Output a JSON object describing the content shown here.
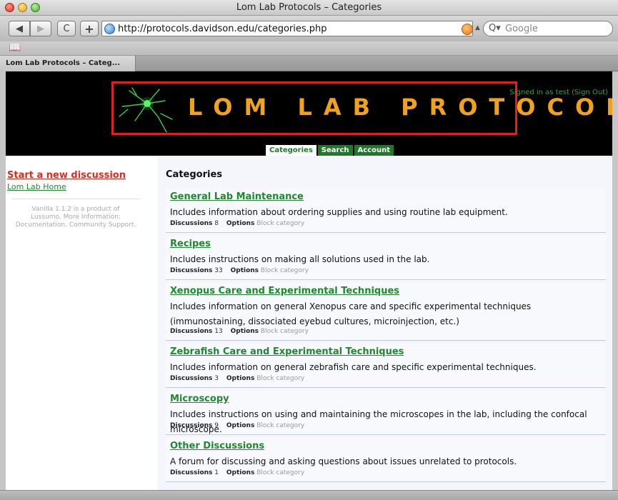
{
  "window": {
    "title": "Lom Lab Protocols – Categories"
  },
  "toolbar": {
    "back": "◀",
    "forward": "▶",
    "reload": "C",
    "add": "+",
    "url": "http://protocols.davidson.edu/categories.php",
    "search_placeholder": "Google",
    "search_icon": "Q▾"
  },
  "bookmarks": {
    "icon": "book-icon"
  },
  "tab": {
    "label": "Lom Lab Protocols – Categ..."
  },
  "header": {
    "logo_text": "LOM LAB PROTOCOLS",
    "signed_in": "Signed in as test",
    "signout": "(Sign Out)"
  },
  "nav": {
    "categories": "Categories",
    "search": "Search",
    "account": "Account"
  },
  "sidebar": {
    "start": "Start a new discussion",
    "home": "Lom Lab Home",
    "vanilla_line1": "Vanilla 1.1.2 is a product of",
    "vanilla_line2": "Lussumo. More Information:",
    "vanilla_line3": "Documentation, Community Support."
  },
  "main": {
    "heading": "Categories",
    "discussions_label": "Discussions",
    "options_label": "Options",
    "block_label": "Block category",
    "categories": [
      {
        "title": "General Lab Maintenance",
        "description": "Includes information about ordering supplies and using routine lab equipment.",
        "discussions": "8"
      },
      {
        "title": "Recipes",
        "description": "Includes instructions on making all solutions used in the lab.",
        "discussions": "33"
      },
      {
        "title": "Xenopus Care and Experimental Techniques",
        "description": "Includes information on general Xenopus care and specific experimental techniques (immunostaining, dissociated eyebud cultures, microinjection, etc.)",
        "discussions": "13"
      },
      {
        "title": "Zebrafish Care and Experimental Techniques",
        "description": "Includes information on general zebrafish care and specific experimental techniques.",
        "discussions": "3"
      },
      {
        "title": "Microscopy",
        "description": "Includes instructions on using and maintaining the microscopes in the lab, including the confocal microscope.",
        "discussions": "9"
      },
      {
        "title": "Other Discussions",
        "description": "A forum for discussing and asking questions about issues unrelated to protocols.",
        "discussions": "1"
      }
    ]
  },
  "colors": {
    "accent_green": "#1e8a2e",
    "link_red": "#e02a1e",
    "logo_orange": "#f0a21c",
    "banner_border": "#e0201c"
  }
}
